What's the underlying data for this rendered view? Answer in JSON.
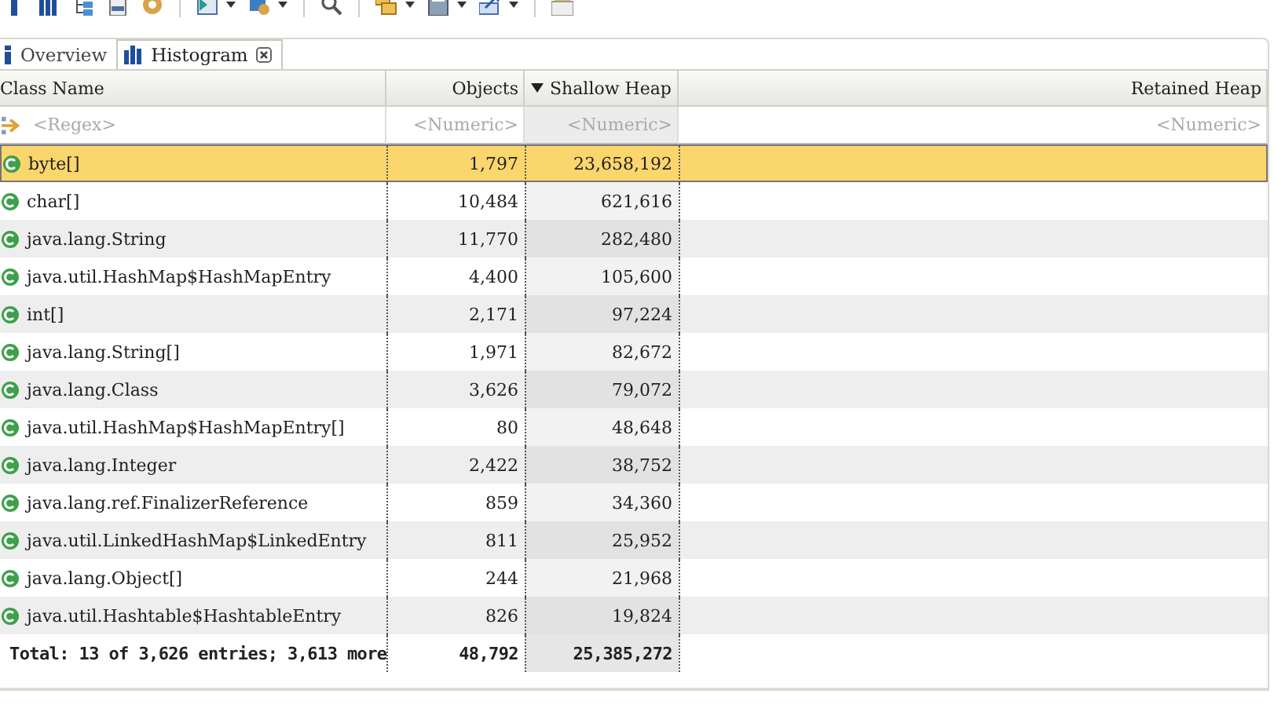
{
  "tabs": [
    {
      "label": "Overview",
      "selected": false,
      "closable": false
    },
    {
      "label": "Histogram",
      "selected": true,
      "closable": true
    }
  ],
  "table": {
    "columns": [
      {
        "label": "Class Name",
        "placeholder": "<Regex>",
        "sorted": false
      },
      {
        "label": "Objects",
        "placeholder": "<Numeric>",
        "sorted": false
      },
      {
        "label": "Shallow Heap",
        "placeholder": "<Numeric>",
        "sorted": true
      },
      {
        "label": "Retained Heap",
        "placeholder": "<Numeric>",
        "sorted": false
      }
    ],
    "rows": [
      {
        "name": "byte[]",
        "objects": "1,797",
        "shallow": "23,658,192",
        "selected": true
      },
      {
        "name": "char[]",
        "objects": "10,484",
        "shallow": "621,616",
        "selected": false
      },
      {
        "name": "java.lang.String",
        "objects": "11,770",
        "shallow": "282,480",
        "selected": false
      },
      {
        "name": "java.util.HashMap$HashMapEntry",
        "objects": "4,400",
        "shallow": "105,600",
        "selected": false
      },
      {
        "name": "int[]",
        "objects": "2,171",
        "shallow": "97,224",
        "selected": false
      },
      {
        "name": "java.lang.String[]",
        "objects": "1,971",
        "shallow": "82,672",
        "selected": false
      },
      {
        "name": "java.lang.Class",
        "objects": "3,626",
        "shallow": "79,072",
        "selected": false
      },
      {
        "name": "java.util.HashMap$HashMapEntry[]",
        "objects": "80",
        "shallow": "48,648",
        "selected": false
      },
      {
        "name": "java.lang.Integer",
        "objects": "2,422",
        "shallow": "38,752",
        "selected": false
      },
      {
        "name": "java.lang.ref.FinalizerReference",
        "objects": "859",
        "shallow": "34,360",
        "selected": false
      },
      {
        "name": "java.util.LinkedHashMap$LinkedEntry",
        "objects": "811",
        "shallow": "25,952",
        "selected": false
      },
      {
        "name": "java.lang.Object[]",
        "objects": "244",
        "shallow": "21,968",
        "selected": false
      },
      {
        "name": "java.util.Hashtable$HashtableEntry",
        "objects": "826",
        "shallow": "19,824",
        "selected": false
      }
    ],
    "total": {
      "label": "Total: 13 of 3,626 entries; 3,613 more",
      "objects": "48,792",
      "shallow": "25,385,272"
    }
  }
}
